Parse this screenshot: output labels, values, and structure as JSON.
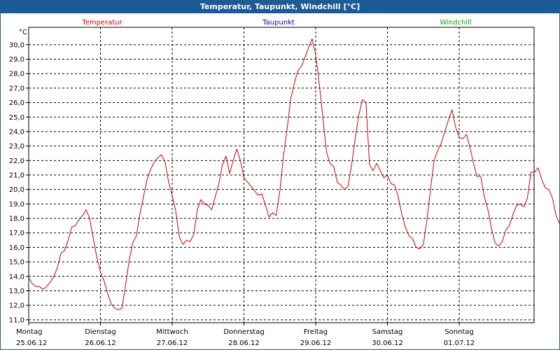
{
  "window": {
    "title": "Temperatur, Taupunkt, Windchill [°C]"
  },
  "chart_data": {
    "type": "line",
    "title": "Temperatur, Taupunkt, Windchill [°C]",
    "unit_label": "°C",
    "legend": [
      {
        "name": "Temperatur",
        "color": "#cc0000"
      },
      {
        "name": "Taupunkt",
        "color": "#0000cc"
      },
      {
        "name": "Windchill",
        "color": "#00aa00"
      }
    ],
    "legend_placement": "top",
    "grid": true,
    "ylim": [
      10.8,
      31.2
    ],
    "yticks": [
      "11,0",
      "12,0",
      "13,0",
      "14,0",
      "15,0",
      "16,0",
      "17,0",
      "18,0",
      "19,0",
      "20,0",
      "21,0",
      "22,0",
      "23,0",
      "24,0",
      "25,0",
      "26,0",
      "27,0",
      "28,0",
      "29,0",
      "30,0"
    ],
    "xlim": [
      0,
      7.17
    ],
    "xticks": [
      {
        "day": "Montag",
        "date": "25.06.12"
      },
      {
        "day": "Dienstag",
        "date": "26.06.12"
      },
      {
        "day": "Mittwoch",
        "date": "27.06.12"
      },
      {
        "day": "Donnerstag",
        "date": "28.06.12"
      },
      {
        "day": "Freitag",
        "date": "29.06.12"
      },
      {
        "day": "Samstag",
        "date": "30.06.12"
      },
      {
        "day": "Sonntag",
        "date": "01.07.12"
      }
    ],
    "series": [
      {
        "name": "Temperatur",
        "color": "#cc0000",
        "points": [
          [
            0.0,
            13.9
          ],
          [
            0.05,
            13.5
          ],
          [
            0.1,
            13.3
          ],
          [
            0.15,
            13.3
          ],
          [
            0.2,
            13.1
          ],
          [
            0.25,
            13.3
          ],
          [
            0.3,
            13.6
          ],
          [
            0.35,
            14.0
          ],
          [
            0.4,
            14.6
          ],
          [
            0.45,
            15.6
          ],
          [
            0.5,
            15.8
          ],
          [
            0.55,
            16.5
          ],
          [
            0.6,
            17.4
          ],
          [
            0.65,
            17.5
          ],
          [
            0.7,
            17.9
          ],
          [
            0.75,
            18.2
          ],
          [
            0.8,
            18.6
          ],
          [
            0.85,
            18.0
          ],
          [
            0.9,
            16.6
          ],
          [
            0.95,
            15.3
          ],
          [
            1.0,
            14.3
          ],
          [
            1.05,
            13.7
          ],
          [
            1.1,
            12.8
          ],
          [
            1.15,
            12.1
          ],
          [
            1.2,
            11.8
          ],
          [
            1.25,
            11.7
          ],
          [
            1.3,
            11.8
          ],
          [
            1.35,
            13.4
          ],
          [
            1.4,
            15.1
          ],
          [
            1.45,
            16.3
          ],
          [
            1.5,
            16.8
          ],
          [
            1.55,
            18.3
          ],
          [
            1.6,
            19.5
          ],
          [
            1.65,
            20.7
          ],
          [
            1.7,
            21.4
          ],
          [
            1.75,
            21.9
          ],
          [
            1.8,
            22.2
          ],
          [
            1.85,
            22.4
          ],
          [
            1.9,
            21.9
          ],
          [
            1.95,
            20.5
          ],
          [
            2.0,
            19.6
          ],
          [
            2.05,
            18.5
          ],
          [
            2.1,
            16.7
          ],
          [
            2.15,
            16.2
          ],
          [
            2.2,
            16.5
          ],
          [
            2.25,
            16.4
          ],
          [
            2.3,
            16.9
          ],
          [
            2.35,
            18.6
          ],
          [
            2.4,
            19.3
          ],
          [
            2.45,
            19.0
          ],
          [
            2.5,
            18.9
          ],
          [
            2.55,
            18.6
          ],
          [
            2.6,
            19.5
          ],
          [
            2.65,
            20.4
          ],
          [
            2.7,
            21.7
          ],
          [
            2.75,
            22.3
          ],
          [
            2.8,
            21.1
          ],
          [
            2.85,
            22.0
          ],
          [
            2.9,
            22.8
          ],
          [
            2.95,
            22.0
          ],
          [
            3.0,
            20.8
          ],
          [
            3.05,
            20.5
          ],
          [
            3.1,
            20.2
          ],
          [
            3.15,
            19.9
          ],
          [
            3.2,
            19.6
          ],
          [
            3.25,
            19.7
          ],
          [
            3.3,
            18.9
          ],
          [
            3.35,
            18.1
          ],
          [
            3.4,
            18.4
          ],
          [
            3.45,
            18.2
          ],
          [
            3.5,
            19.9
          ],
          [
            3.55,
            22.3
          ],
          [
            3.6,
            24.1
          ],
          [
            3.65,
            26.2
          ],
          [
            3.7,
            27.3
          ],
          [
            3.75,
            28.2
          ],
          [
            3.8,
            28.5
          ],
          [
            3.85,
            29.1
          ],
          [
            3.9,
            29.8
          ],
          [
            3.95,
            30.4
          ],
          [
            4.0,
            29.3
          ],
          [
            4.05,
            27.3
          ],
          [
            4.1,
            25.0
          ],
          [
            4.15,
            22.6
          ],
          [
            4.2,
            21.8
          ],
          [
            4.25,
            21.6
          ],
          [
            4.3,
            20.5
          ],
          [
            4.35,
            20.3
          ],
          [
            4.4,
            20.0
          ],
          [
            4.45,
            20.2
          ],
          [
            4.5,
            21.7
          ],
          [
            4.55,
            23.5
          ],
          [
            4.6,
            25.1
          ],
          [
            4.65,
            26.2
          ],
          [
            4.7,
            26.0
          ],
          [
            4.75,
            21.7
          ],
          [
            4.8,
            21.3
          ],
          [
            4.85,
            21.8
          ],
          [
            4.9,
            21.3
          ],
          [
            4.95,
            20.8
          ],
          [
            5.0,
            21.0
          ],
          [
            5.05,
            20.4
          ],
          [
            5.1,
            20.3
          ],
          [
            5.15,
            19.5
          ],
          [
            5.2,
            18.3
          ],
          [
            5.25,
            17.4
          ],
          [
            5.3,
            16.8
          ],
          [
            5.35,
            16.6
          ],
          [
            5.4,
            16.0
          ],
          [
            5.45,
            15.9
          ],
          [
            5.5,
            16.2
          ],
          [
            5.55,
            17.9
          ],
          [
            5.6,
            20.0
          ],
          [
            5.65,
            22.0
          ],
          [
            5.7,
            22.7
          ],
          [
            5.75,
            23.2
          ],
          [
            5.8,
            24.0
          ],
          [
            5.85,
            24.8
          ],
          [
            5.9,
            25.5
          ],
          [
            5.95,
            24.3
          ],
          [
            6.0,
            23.6
          ],
          [
            6.05,
            23.5
          ],
          [
            6.1,
            23.8
          ],
          [
            6.15,
            22.9
          ],
          [
            6.2,
            21.8
          ],
          [
            6.25,
            20.9
          ],
          [
            6.3,
            20.9
          ],
          [
            6.35,
            19.5
          ],
          [
            6.4,
            18.6
          ],
          [
            6.45,
            17.3
          ],
          [
            6.5,
            16.3
          ],
          [
            6.55,
            16.1
          ],
          [
            6.6,
            16.4
          ],
          [
            6.65,
            17.2
          ],
          [
            6.7,
            17.5
          ],
          [
            6.75,
            18.3
          ],
          [
            6.8,
            18.9
          ],
          [
            6.85,
            19.0
          ],
          [
            6.9,
            18.8
          ],
          [
            6.95,
            19.4
          ],
          [
            7.0,
            21.2
          ],
          [
            7.05,
            21.2
          ],
          [
            7.1,
            21.5
          ],
          [
            7.15,
            20.7
          ],
          [
            7.2,
            20.1
          ],
          [
            7.25,
            20.0
          ],
          [
            7.3,
            19.4
          ],
          [
            7.35,
            18.2
          ],
          [
            7.4,
            17.6
          ]
        ]
      }
    ]
  }
}
